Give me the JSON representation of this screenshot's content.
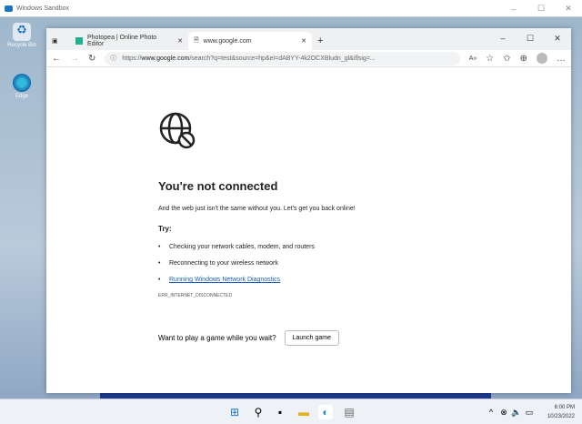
{
  "sandbox": {
    "title": "Windows Sandbox"
  },
  "desktop": {
    "icons": [
      {
        "label": "Recycle Bin"
      },
      {
        "label": "Edge"
      }
    ]
  },
  "browser": {
    "tabs": [
      {
        "label": "Photopea | Online Photo Editor",
        "active": false
      },
      {
        "label": "www.google.com",
        "active": true
      }
    ],
    "url_prefix": "https://",
    "url_domain": "www.google.com",
    "url_rest": "/search?q=test&source=hp&ei=dABYY-4k2OCXBludn_gl&iflsig=..."
  },
  "page": {
    "title": "You're not connected",
    "subtitle": "And the web just isn't the same without you. Let's get you back online!",
    "try_label": "Try:",
    "suggestions": [
      "Checking your network cables, modem, and routers",
      "Reconnecting to your wireless network",
      "Running Windows Network Diagnostics"
    ],
    "error_code": "ERR_INTERNET_DISCONNECTED",
    "game_prompt": "Want to play a game while you wait?",
    "game_button": "Launch game"
  },
  "taskbar": {
    "time": "6:00 PM",
    "date": "10/23/2022"
  },
  "colors": {
    "accent": "#1a5fb4",
    "taskbar": "#eef1f6"
  }
}
